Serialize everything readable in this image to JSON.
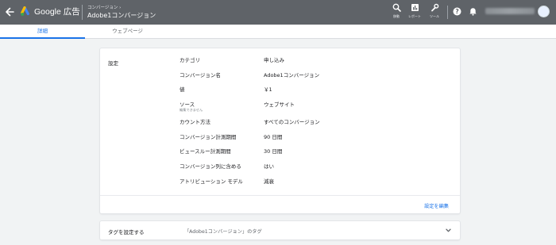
{
  "header": {
    "brand": "Google 広告",
    "breadcrumb": "コンバージョン  ›",
    "title": "Adobe1コンバージョン",
    "tools": [
      {
        "label": "移動",
        "icon": "search-icon"
      },
      {
        "label": "レポート",
        "icon": "reports-icon"
      },
      {
        "label": "ツール",
        "icon": "wrench-icon"
      }
    ],
    "help_icon": "help-icon",
    "notifications_icon": "bell-icon"
  },
  "tabs": [
    {
      "label": "詳細",
      "active": true
    },
    {
      "label": "ウェブページ",
      "active": false
    }
  ],
  "settings": {
    "section_label": "設定",
    "rows": [
      {
        "key": "カテゴリ",
        "value": "申し込み"
      },
      {
        "key": "コンバージョン名",
        "value": "Adobe1コンバージョン"
      },
      {
        "key": "値",
        "value": "￥1"
      },
      {
        "key": "ソース",
        "sub": "編集できません",
        "value": "ウェブサイト"
      },
      {
        "key": "カウント方法",
        "value": "すべてのコンバージョン"
      },
      {
        "key": "コンバージョン計測期間",
        "value": "90 日間"
      },
      {
        "key": "ビュースルー計測期間",
        "value": "30 日間"
      },
      {
        "key": "コンバージョン列に含める",
        "value": "はい"
      },
      {
        "key": "アトリビューション モデル",
        "value": "減衰"
      }
    ],
    "edit_label": "設定を編集"
  },
  "tag_section": {
    "title": "タグを設定する",
    "description": "「Adobe1コンバージョン」のタグ"
  },
  "colors": {
    "topbar": "#5f6368",
    "accent": "#1a73e8"
  }
}
